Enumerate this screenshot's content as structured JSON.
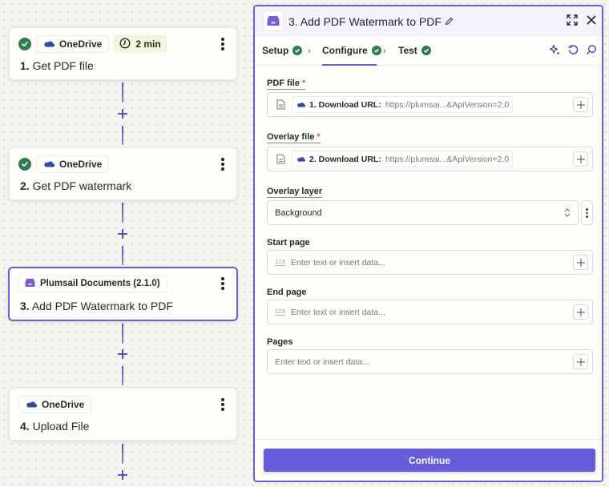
{
  "canvas": {
    "steps": [
      {
        "number": "1.",
        "title": "Get PDF file",
        "app": "OneDrive",
        "completed": true,
        "duration": "2 min",
        "selected": false
      },
      {
        "number": "2.",
        "title": "Get PDF watermark",
        "app": "OneDrive",
        "completed": true,
        "selected": false
      },
      {
        "number": "3.",
        "title": "Add PDF Watermark to PDF",
        "app": "Plumsail Documents (2.1.0)",
        "completed": false,
        "selected": true
      },
      {
        "number": "4.",
        "title": "Upload File",
        "app": "OneDrive",
        "completed": false,
        "selected": false
      }
    ]
  },
  "panel": {
    "title": "3. Add PDF Watermark to PDF",
    "tabs": [
      {
        "label": "Setup",
        "completed": true
      },
      {
        "label": "Configure",
        "completed": true,
        "active": true
      },
      {
        "label": "Test",
        "completed": true
      }
    ],
    "fields": {
      "pdf_file": {
        "label": "PDF file",
        "required": "*",
        "token_label": "1. Download URL:",
        "token_value": "https://plumsai...&ApiVersion=2.0"
      },
      "overlay_file": {
        "label": "Overlay file",
        "required": "*",
        "token_label": "2. Download URL:",
        "token_value": "https://plumsai...&ApiVersion=2.0"
      },
      "overlay_layer": {
        "label": "Overlay layer",
        "value": "Background"
      },
      "start_page": {
        "label": "Start page",
        "type_hint": "123",
        "placeholder": "Enter text or insert data..."
      },
      "end_page": {
        "label": "End page",
        "type_hint": "123",
        "placeholder": "Enter text or insert data..."
      },
      "pages": {
        "label": "Pages",
        "placeholder": "Enter text or insert data..."
      }
    },
    "continue_label": "Continue"
  },
  "colors": {
    "accent": "#6a5fd8",
    "button": "#675cdc",
    "success": "#2e7d4f",
    "onedrive": "#2b4bb3",
    "plumsail": "#7b5cd6",
    "required": "#e0603a"
  }
}
